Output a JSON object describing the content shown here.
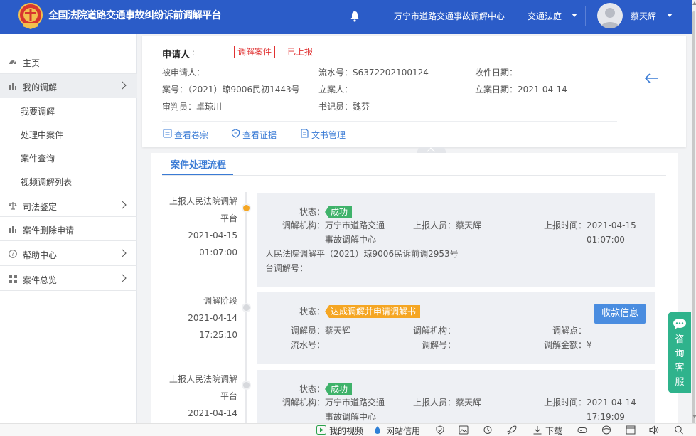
{
  "header": {
    "app_title": "全国法院道路交通事故纠纷诉前调解平台",
    "center_name": "万宁市道路交通事故调解中心",
    "court_menu": "交通法庭",
    "user_name": "蔡天辉",
    "icons": [
      "court-emblem-icon",
      "bell-icon",
      "avatar"
    ],
    "colors": {
      "primary": "#2b5cc8"
    }
  },
  "sidebar": {
    "items": [
      {
        "label": "主页",
        "icon": "dashboard-icon"
      },
      {
        "label": "我的调解",
        "icon": "mediation-icon"
      },
      {
        "label": "司法鉴定",
        "icon": "scale-icon"
      },
      {
        "label": "案件删除申请",
        "icon": "delete-request-icon"
      },
      {
        "label": "帮助中心",
        "icon": "help-icon"
      },
      {
        "label": "案件总览",
        "icon": "grid-icon"
      }
    ],
    "sub_items": [
      "我要调解",
      "处理中案件",
      "案件查询",
      "视频调解列表"
    ]
  },
  "case": {
    "applicant_label": "申请人",
    "applicant_value": ":",
    "tags": [
      "调解案件",
      "已上报"
    ],
    "respondent": "被申请人：",
    "serial_no": "流水号：S6372202100124",
    "receive_date": "收件日期：",
    "case_no": "案号：（2021）琼9006民初1443号",
    "filer": "立案人：",
    "filing_date": "立案日期：2021-04-14",
    "judge": "审判员：卓琼川",
    "clerk": "书记员：魏芬",
    "links": [
      "查看卷宗",
      "查看证据",
      "文书管理"
    ],
    "colors": {
      "link": "#3a7bd5",
      "tag": "#e03131"
    }
  },
  "process": {
    "tab_label": "案件处理流程",
    "entries": [
      {
        "stage_line1": "上报人民法院调解",
        "stage_line2": "平台",
        "date": "2021-04-15",
        "time": "01:07:00",
        "status_label": "状态：",
        "status": "成功",
        "org_label": "调解机构：",
        "org_line1": "万宁市道路交通",
        "org_line2": "事故调解中心",
        "reporter": "上报人员：蔡天辉",
        "report_time_label": "上报时间：",
        "report_date": "2021-04-15",
        "report_time": "01:07:00",
        "court_no_label1": "人民法院调解平",
        "court_no_label2": "台调解号：",
        "court_no_value": "（2021）琼9006民诉前调2953号"
      },
      {
        "stage": "调解阶段",
        "date": "2021-04-14",
        "time": "17:25:10",
        "status_label": "状态：",
        "status": "达成调解并申请调解书",
        "mediator": "调解员：蔡天辉",
        "org": "调解机构：",
        "point": "调解点：",
        "serial": "流水号：",
        "med_no": "调解号：",
        "amount": "调解金额：¥",
        "button": "收款信息"
      },
      {
        "stage_line1": "上报人民法院调解",
        "stage_line2": "平台",
        "date": "2021-04-14",
        "status_label": "状态：",
        "status": "成功",
        "org_label": "调解机构：",
        "org_line1": "万宁市道路交通",
        "org_line2": "事故调解中心",
        "reporter": "上报人员：蔡天辉",
        "report_time_label": "上报时间：",
        "report_date": "2021-04-14",
        "report_time": "17:19:09"
      }
    ],
    "colors": {
      "success": "#3fb26a",
      "pending": "#f5a623",
      "active_dot": "#f5a623"
    }
  },
  "float_help": {
    "label": "咨询客服"
  },
  "statusbar": {
    "my_video": "我的视频",
    "site_credit": "网站信用",
    "download": "下载"
  }
}
